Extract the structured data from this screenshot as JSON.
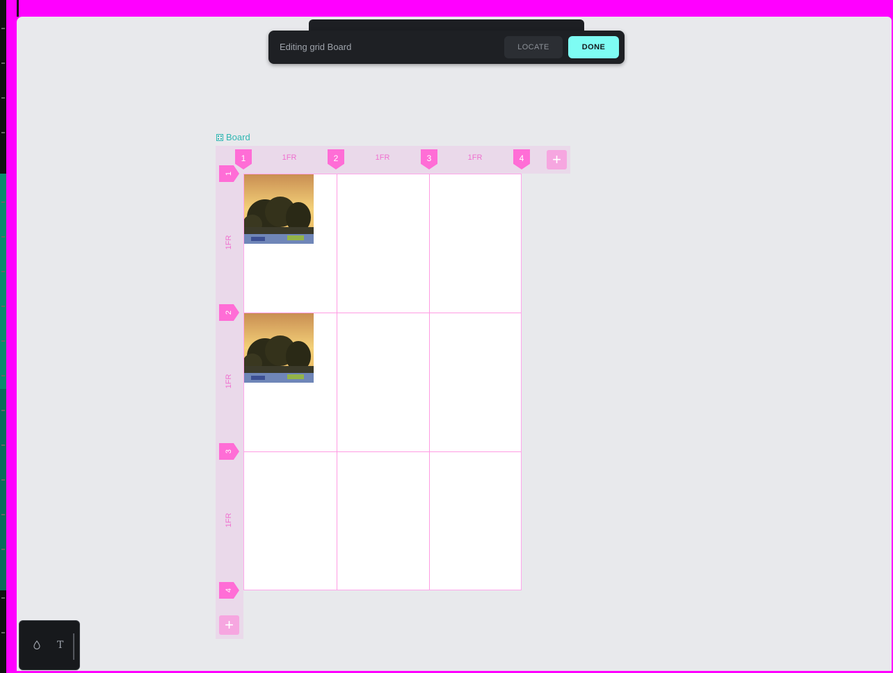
{
  "toolbar": {
    "title": "Editing grid Board",
    "locate_label": "LOCATE",
    "done_label": "DONE"
  },
  "board": {
    "name": "Board",
    "columns": [
      {
        "line": "1",
        "size": "1FR"
      },
      {
        "line": "2",
        "size": "1FR"
      },
      {
        "line": "3",
        "size": "1FR"
      },
      {
        "line": "4",
        "size": ""
      }
    ],
    "rows": [
      {
        "line": "1",
        "size": "1FR"
      },
      {
        "line": "2",
        "size": "1FR"
      },
      {
        "line": "3",
        "size": "1FR"
      },
      {
        "line": "4",
        "size": ""
      }
    ],
    "add_symbol": "+"
  },
  "tools": {
    "fill_icon": "droplet-icon",
    "text_icon": "text-icon",
    "text_glyph": "T"
  },
  "colors": {
    "accent": "#7efcf3",
    "grid_marker": "#ff6dd6",
    "board_label": "#30b7b2",
    "frame": "#ff00ff"
  }
}
